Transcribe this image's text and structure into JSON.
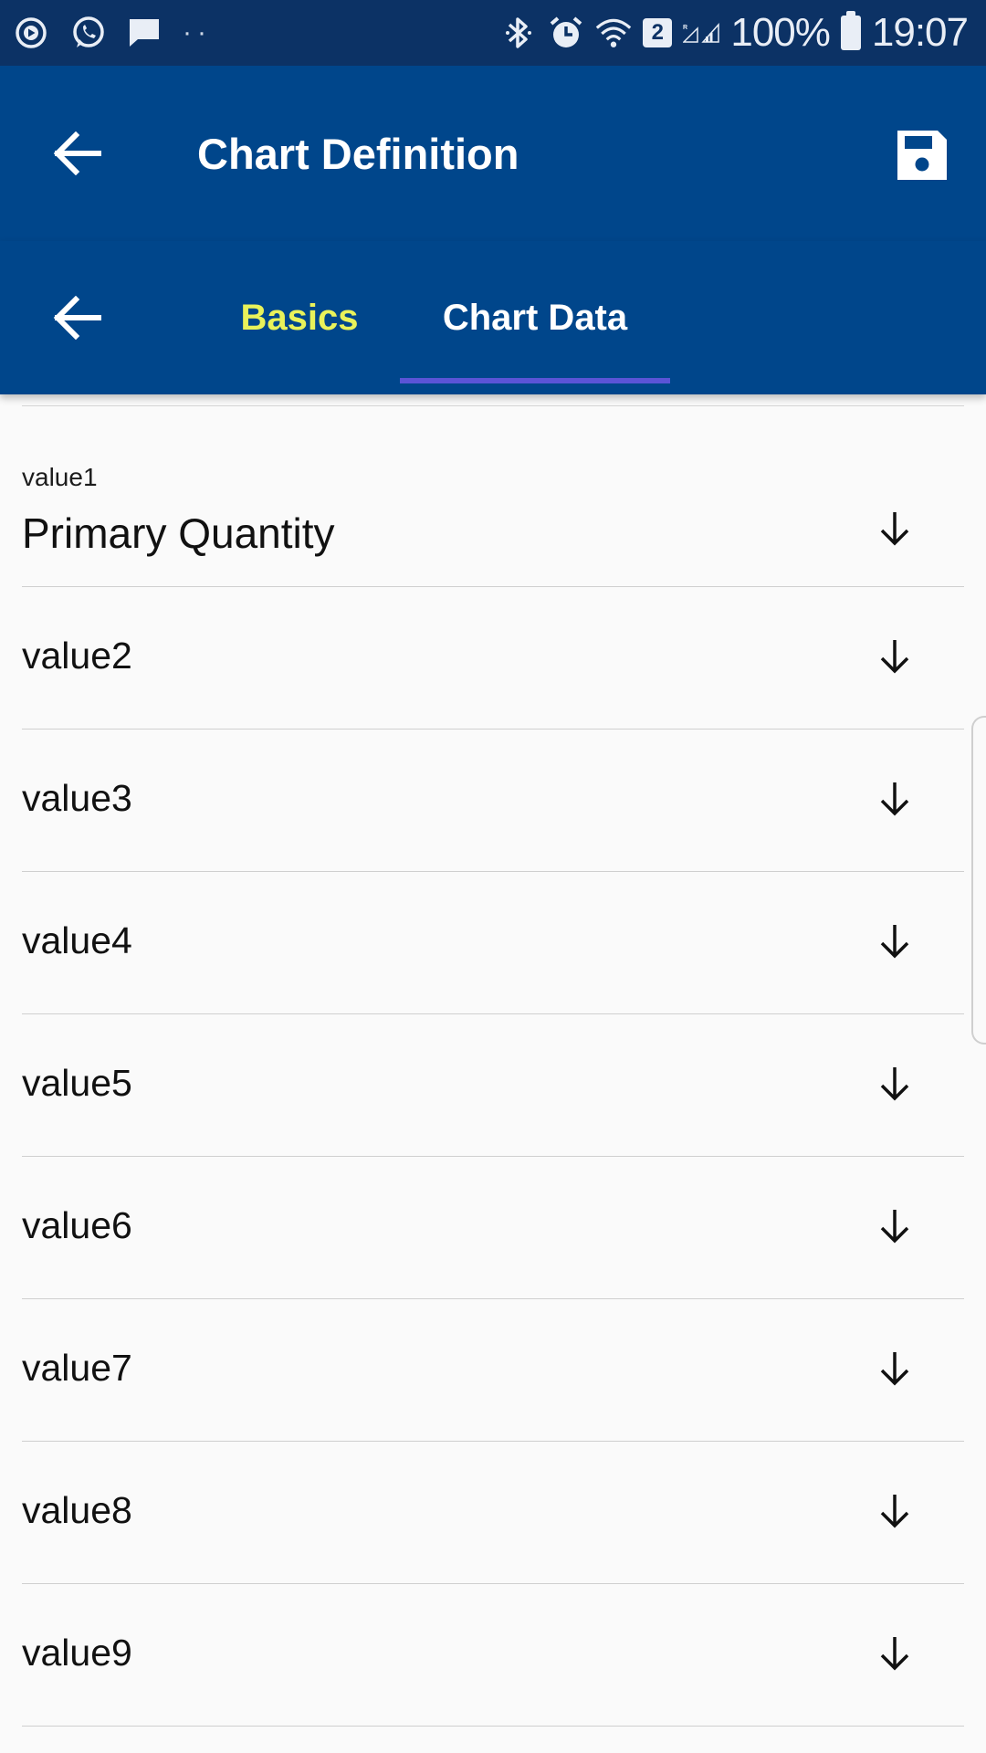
{
  "status_bar": {
    "left_icons": [
      "play-circle-icon",
      "whatsapp-icon",
      "message-icon",
      "more-dots-icon"
    ],
    "right_icons": [
      "bluetooth-icon",
      "alarm-icon",
      "wifi-icon",
      "sim-icon",
      "signal-icon"
    ],
    "sim_number": "2",
    "battery": "100%",
    "time": "19:07"
  },
  "app_bar": {
    "title": "Chart Definition"
  },
  "tabs": [
    {
      "label": "Basics",
      "active": false,
      "color": "#e9f25a"
    },
    {
      "label": "Chart Data",
      "active": true,
      "color": "#ffffff"
    }
  ],
  "list": {
    "items": [
      {
        "label": "value1",
        "value": "Primary Quantity"
      },
      {
        "label": "value2"
      },
      {
        "label": "value3"
      },
      {
        "label": "value4"
      },
      {
        "label": "value5"
      },
      {
        "label": "value6"
      },
      {
        "label": "value7"
      },
      {
        "label": "value8"
      },
      {
        "label": "value9"
      }
    ]
  },
  "colors": {
    "status_bar": "#0c3265",
    "app_bar": "#00468b",
    "tab_indicator": "#5b54d6",
    "background": "#fafafa"
  }
}
